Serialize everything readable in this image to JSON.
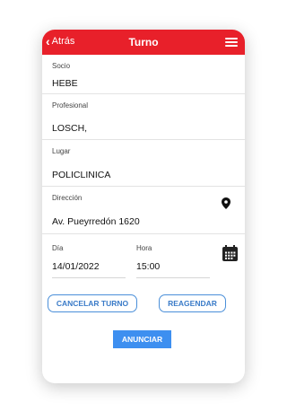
{
  "header": {
    "back_label": "Atrás",
    "title": "Turno",
    "back_icon": "chevron-left-icon",
    "menu_icon": "hamburger-menu-icon"
  },
  "fields": {
    "socio": {
      "label": "Socio",
      "value": "HEBE"
    },
    "profesional": {
      "label": "Profesional",
      "value": "LOSCH,"
    },
    "lugar": {
      "label": "Lugar",
      "value": "POLICLINICA"
    },
    "direccion": {
      "label": "Dirección",
      "value": "Av. Pueyrredón 1620",
      "icon": "location-pin-icon"
    },
    "dia": {
      "label": "Día",
      "value": "14/01/2022"
    },
    "hora": {
      "label": "Hora",
      "value": "15:00"
    },
    "calendar_icon": "calendar-icon"
  },
  "buttons": {
    "cancelar": "CANCELAR TURNO",
    "reagendar": "REAGENDAR",
    "anunciar": "ANUNCIAR"
  },
  "colors": {
    "header_bg": "#e8202a",
    "outline_button": "#4a8fd9",
    "primary_button": "#3d8ff0"
  }
}
